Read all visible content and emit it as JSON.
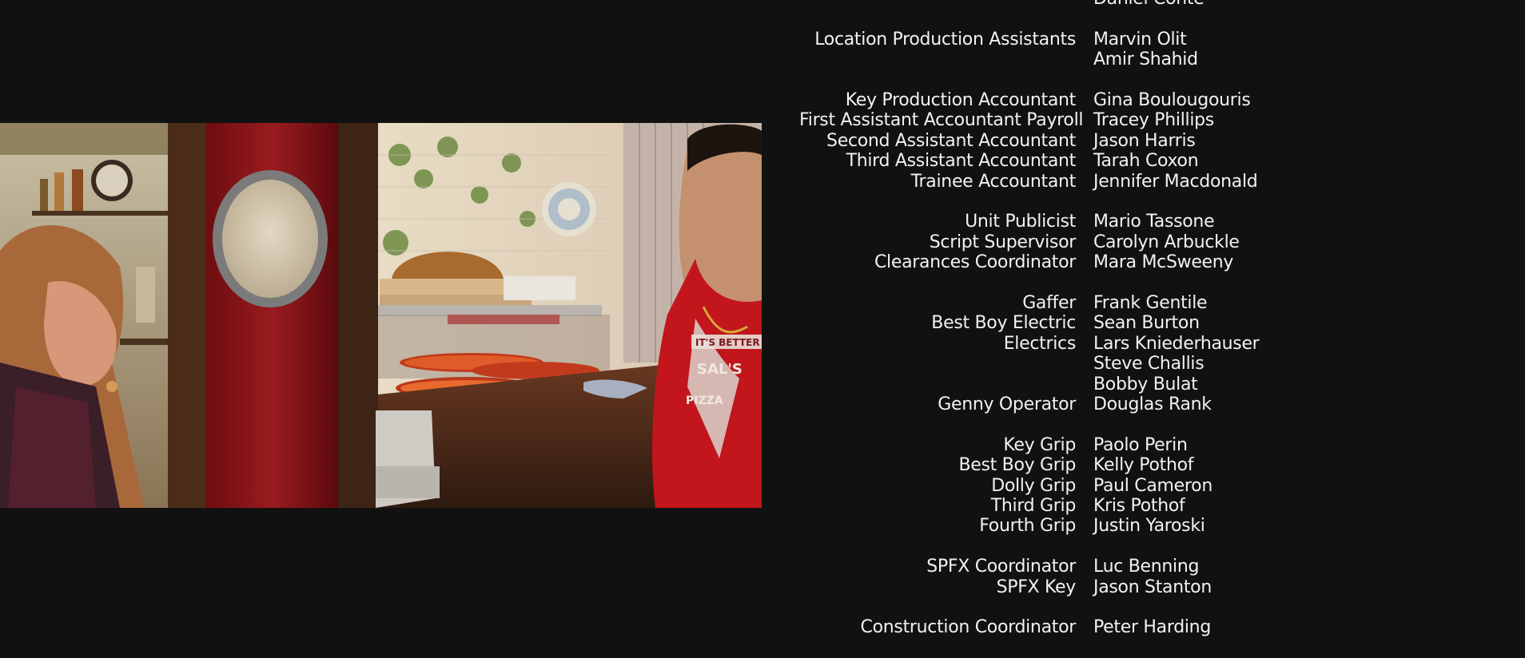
{
  "video_frame": {
    "scene": "pizzeria-kitchen",
    "shirt_text": [
      "IT'S BETTER",
      "SAL'S",
      "PIZZA"
    ]
  },
  "credits": [
    {
      "entries": [
        {
          "role": "",
          "names": [
            "Daniel Conte"
          ]
        }
      ]
    },
    {
      "entries": [
        {
          "role": "Location Production Assistants",
          "names": [
            "Marvin Olit",
            "Amir Shahid"
          ]
        }
      ]
    },
    {
      "entries": [
        {
          "role": "Key Production Accountant",
          "names": [
            "Gina Boulougouris"
          ]
        },
        {
          "role": "First Assistant Accountant Payroll",
          "names": [
            "Tracey Phillips"
          ]
        },
        {
          "role": "Second Assistant Accountant",
          "names": [
            "Jason Harris"
          ]
        },
        {
          "role": "Third Assistant Accountant",
          "names": [
            "Tarah Coxon"
          ]
        },
        {
          "role": "Trainee Accountant",
          "names": [
            "Jennifer Macdonald"
          ]
        }
      ]
    },
    {
      "entries": [
        {
          "role": "Unit Publicist",
          "names": [
            "Mario Tassone"
          ]
        },
        {
          "role": "Script Supervisor",
          "names": [
            "Carolyn Arbuckle"
          ]
        },
        {
          "role": "Clearances Coordinator",
          "names": [
            "Mara McSweeny"
          ]
        }
      ]
    },
    {
      "entries": [
        {
          "role": "Gaffer",
          "names": [
            "Frank Gentile"
          ]
        },
        {
          "role": "Best Boy Electric",
          "names": [
            "Sean Burton"
          ]
        },
        {
          "role": "Electrics",
          "names": [
            "Lars Kniederhauser",
            "Steve Challis",
            "Bobby Bulat"
          ]
        },
        {
          "role": "Genny Operator",
          "names": [
            "Douglas Rank"
          ]
        }
      ]
    },
    {
      "entries": [
        {
          "role": "Key Grip",
          "names": [
            "Paolo Perin"
          ]
        },
        {
          "role": "Best Boy Grip",
          "names": [
            "Kelly Pothof"
          ]
        },
        {
          "role": "Dolly Grip",
          "names": [
            "Paul Cameron"
          ]
        },
        {
          "role": "Third Grip",
          "names": [
            "Kris Pothof"
          ]
        },
        {
          "role": "Fourth Grip",
          "names": [
            "Justin Yaroski"
          ]
        }
      ]
    },
    {
      "entries": [
        {
          "role": "SPFX Coordinator",
          "names": [
            "Luc Benning"
          ]
        },
        {
          "role": "SPFX Key",
          "names": [
            "Jason Stanton"
          ]
        }
      ]
    },
    {
      "entries": [
        {
          "role": "Construction Coordinator",
          "names": [
            "Peter Harding"
          ]
        }
      ]
    }
  ]
}
